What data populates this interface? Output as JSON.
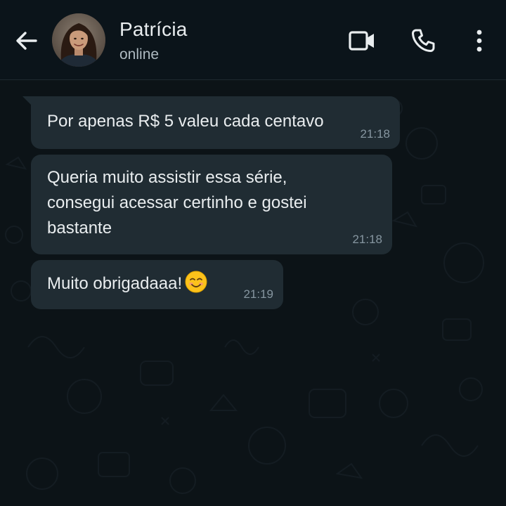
{
  "header": {
    "back_icon": "arrow-left-icon",
    "contact_name": "Patrícia",
    "contact_status": "online",
    "video_icon": "video-camera-icon",
    "call_icon": "phone-icon",
    "menu_icon": "more-vertical-icon"
  },
  "messages": [
    {
      "text": "Por apenas R$ 5 valeu cada centavo",
      "time": "21:18"
    },
    {
      "text": "Queria muito assistir essa série,\nconsegui acessar certinho e gostei\nbastante",
      "time": "21:18"
    },
    {
      "text": "Muito obrigadaaa!",
      "emoji": "smiling-face-emoji",
      "time": "21:19"
    }
  ],
  "colors": {
    "header_bg": "#0b141a",
    "chat_bg": "#0c1317",
    "bubble_bg": "#202c33",
    "text_primary": "#e9edef",
    "text_secondary": "#8696a0"
  }
}
